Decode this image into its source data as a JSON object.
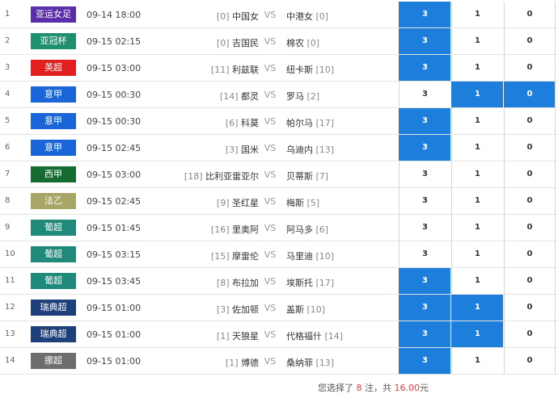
{
  "matches": [
    {
      "index": "1",
      "league": "亚运女足",
      "color": "#5a2ea8",
      "time": "09-14 18:00",
      "home_rank": "[0]",
      "home": "中国女",
      "vs": "VS",
      "away": "中港女",
      "away_rank": "[0]",
      "odds": [
        "3",
        "1",
        "0"
      ],
      "selected": [
        true,
        false,
        false
      ]
    },
    {
      "index": "2",
      "league": "亚冠杯",
      "color": "#1f8f6e",
      "time": "09-15 02:15",
      "home_rank": "[0]",
      "home": "吉国民",
      "vs": "VS",
      "away": "棉农",
      "away_rank": "[0]",
      "odds": [
        "3",
        "1",
        "0"
      ],
      "selected": [
        true,
        false,
        false
      ]
    },
    {
      "index": "3",
      "league": "英超",
      "color": "#e21f1f",
      "time": "09-15 03:00",
      "home_rank": "[11]",
      "home": "利兹联",
      "vs": "VS",
      "away": "纽卡斯",
      "away_rank": "[10]",
      "odds": [
        "3",
        "1",
        "0"
      ],
      "selected": [
        true,
        false,
        false
      ]
    },
    {
      "index": "4",
      "league": "意甲",
      "color": "#1a66d9",
      "time": "09-15 00:30",
      "home_rank": "[14]",
      "home": "都灵",
      "vs": "VS",
      "away": "罗马",
      "away_rank": "[2]",
      "odds": [
        "3",
        "1",
        "0"
      ],
      "selected": [
        false,
        true,
        true
      ]
    },
    {
      "index": "5",
      "league": "意甲",
      "color": "#1a66d9",
      "time": "09-15 00:30",
      "home_rank": "[6]",
      "home": "科莫",
      "vs": "VS",
      "away": "帕尔马",
      "away_rank": "[17]",
      "odds": [
        "3",
        "1",
        "0"
      ],
      "selected": [
        true,
        false,
        false
      ]
    },
    {
      "index": "6",
      "league": "意甲",
      "color": "#1a66d9",
      "time": "09-15 02:45",
      "home_rank": "[3]",
      "home": "国米",
      "vs": "VS",
      "away": "乌迪内",
      "away_rank": "[13]",
      "odds": [
        "3",
        "1",
        "0"
      ],
      "selected": [
        true,
        false,
        false
      ]
    },
    {
      "index": "7",
      "league": "西甲",
      "color": "#166b30",
      "time": "09-15 03:00",
      "home_rank": "[18]",
      "home": "比利亚雷亚尔",
      "vs": "VS",
      "away": "贝蒂斯",
      "away_rank": "[7]",
      "odds": [
        "3",
        "1",
        "0"
      ],
      "selected": [
        false,
        false,
        false
      ]
    },
    {
      "index": "8",
      "league": "法乙",
      "color": "#a8a666",
      "time": "09-15 02:45",
      "home_rank": "[9]",
      "home": "圣红星",
      "vs": "VS",
      "away": "梅斯",
      "away_rank": "[5]",
      "odds": [
        "3",
        "1",
        "0"
      ],
      "selected": [
        false,
        false,
        false
      ]
    },
    {
      "index": "9",
      "league": "葡超",
      "color": "#1f8a7a",
      "time": "09-15 01:45",
      "home_rank": "[16]",
      "home": "里奥阿",
      "vs": "VS",
      "away": "阿马多",
      "away_rank": "[6]",
      "odds": [
        "3",
        "1",
        "0"
      ],
      "selected": [
        false,
        false,
        false
      ]
    },
    {
      "index": "10",
      "league": "葡超",
      "color": "#1f8a7a",
      "time": "09-15 03:15",
      "home_rank": "[15]",
      "home": "摩雷伦",
      "vs": "VS",
      "away": "马里迪",
      "away_rank": "[10]",
      "odds": [
        "3",
        "1",
        "0"
      ],
      "selected": [
        false,
        false,
        false
      ]
    },
    {
      "index": "11",
      "league": "葡超",
      "color": "#1f8a7a",
      "time": "09-15 03:45",
      "home_rank": "[8]",
      "home": "布拉加",
      "vs": "VS",
      "away": "埃斯托",
      "away_rank": "[17]",
      "odds": [
        "3",
        "1",
        "0"
      ],
      "selected": [
        true,
        false,
        false
      ]
    },
    {
      "index": "12",
      "league": "瑞典超",
      "color": "#1e3f7a",
      "time": "09-15 01:00",
      "home_rank": "[3]",
      "home": "佐加顿",
      "vs": "VS",
      "away": "盖斯",
      "away_rank": "[10]",
      "odds": [
        "3",
        "1",
        "0"
      ],
      "selected": [
        true,
        true,
        false
      ]
    },
    {
      "index": "13",
      "league": "瑞典超",
      "color": "#1e3f7a",
      "time": "09-15 01:00",
      "home_rank": "[1]",
      "home": "天狼星",
      "vs": "VS",
      "away": "代格福什",
      "away_rank": "[14]",
      "odds": [
        "3",
        "1",
        "0"
      ],
      "selected": [
        true,
        true,
        false
      ]
    },
    {
      "index": "14",
      "league": "挪超",
      "color": "#6d6d6d",
      "time": "09-15 01:00",
      "home_rank": "[1]",
      "home": "博德",
      "vs": "VS",
      "away": "桑纳菲",
      "away_rank": "[13]",
      "odds": [
        "3",
        "1",
        "0"
      ],
      "selected": [
        true,
        false,
        false
      ]
    }
  ],
  "summary": {
    "prefix": "您选择了",
    "count": "8",
    "mid": "注，共",
    "amount": "16.00",
    "suffix": "元"
  }
}
